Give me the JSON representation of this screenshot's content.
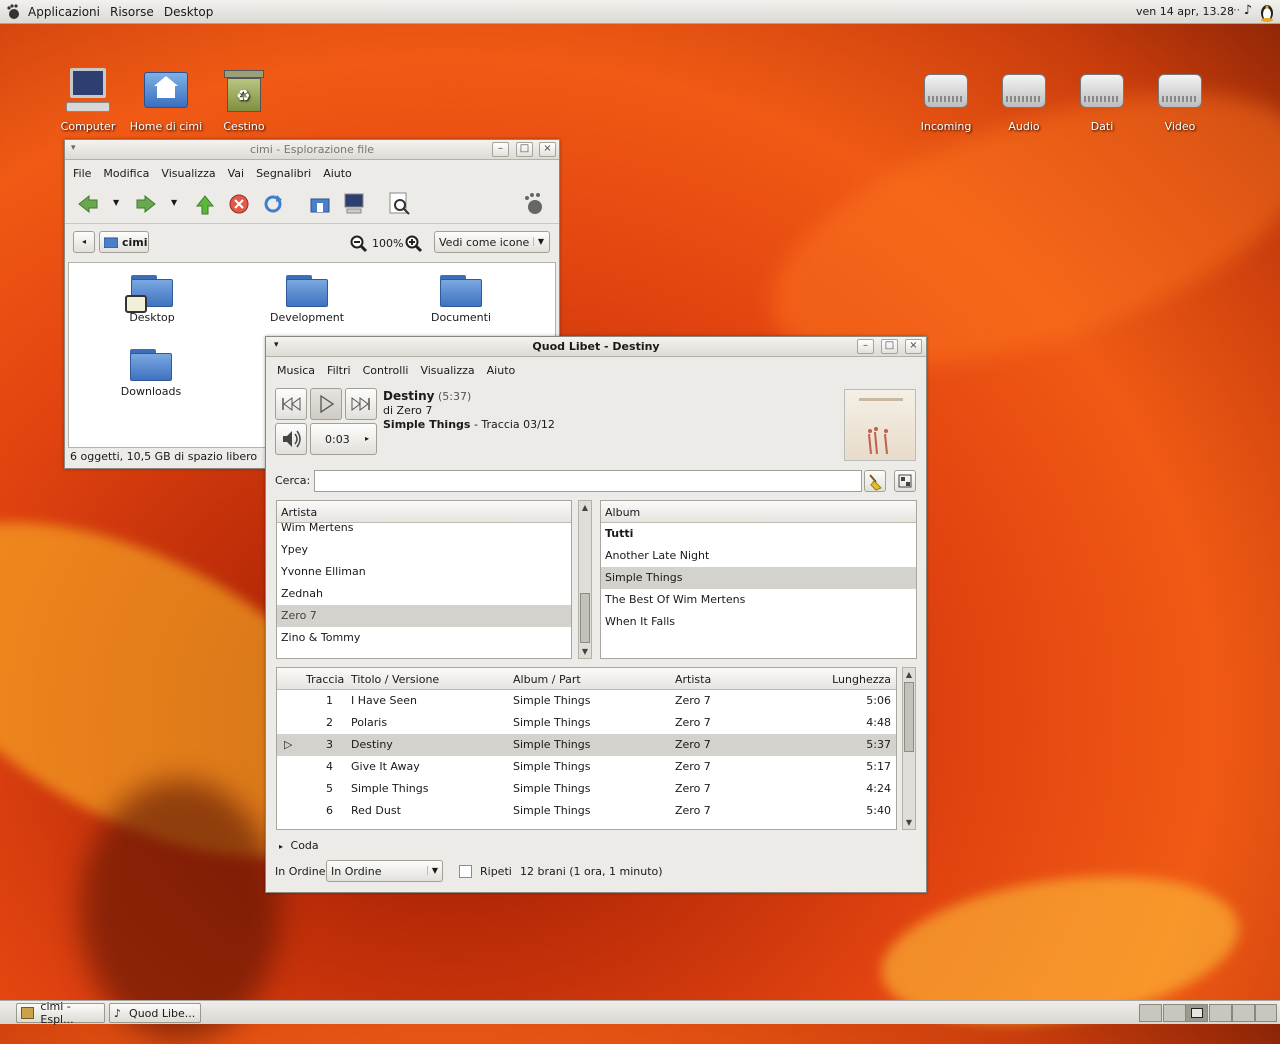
{
  "top_panel": {
    "menus": [
      "Applicazioni",
      "Risorse",
      "Desktop"
    ],
    "clock": "ven 14 apr, 13.28"
  },
  "desktop_icons": {
    "left": [
      "Computer",
      "Home di cimi",
      "Cestino"
    ],
    "right": [
      "Incoming",
      "Audio",
      "Dati",
      "Video"
    ]
  },
  "file_manager": {
    "title": "cimi - Esplorazione file",
    "menu": [
      "File",
      "Modifica",
      "Visualizza",
      "Vai",
      "Segnalibri",
      "Aiuto"
    ],
    "location": "cimi",
    "zoom": "100%",
    "view_mode": "Vedi come icone",
    "folders": [
      "Desktop",
      "Development",
      "Documenti",
      "Downloads"
    ],
    "status": "6 oggetti, 10,5 GB di spazio libero"
  },
  "quodlibet": {
    "title": "Quod Libet - Destiny",
    "menu": [
      "Musica",
      "Filtri",
      "Controlli",
      "Visualizza",
      "Aiuto"
    ],
    "now_playing": {
      "song": "Destiny",
      "length": "(5:37)",
      "artist": "di Zero 7",
      "album": "Simple Things",
      "track_info": " - Traccia 03/12",
      "position": "0:03"
    },
    "search_label": "Cerca:",
    "search_value": "",
    "artist_header": "Artista",
    "artists": [
      "Wim Mertens",
      "Ypey",
      "Yvonne Elliman",
      "Zednah",
      "Zero 7",
      "Zino & Tommy"
    ],
    "selected_artist_index": 4,
    "album_header": "Album",
    "albums": [
      "Tutti",
      "Another Late Night",
      "Simple Things",
      "The Best Of Wim Mertens",
      "When It Falls"
    ],
    "selected_album_index": 2,
    "song_columns": [
      "Traccia",
      "Titolo / Versione",
      "Album / Part",
      "Artista",
      "Lunghezza"
    ],
    "songs": [
      {
        "track": "1",
        "title": "I Have Seen",
        "album": "Simple Things",
        "artist": "Zero 7",
        "length": "5:06"
      },
      {
        "track": "2",
        "title": "Polaris",
        "album": "Simple Things",
        "artist": "Zero 7",
        "length": "4:48"
      },
      {
        "track": "3",
        "title": "Destiny",
        "album": "Simple Things",
        "artist": "Zero 7",
        "length": "5:37"
      },
      {
        "track": "4",
        "title": "Give It Away",
        "album": "Simple Things",
        "artist": "Zero 7",
        "length": "5:17"
      },
      {
        "track": "5",
        "title": "Simple Things",
        "album": "Simple Things",
        "artist": "Zero 7",
        "length": "4:24"
      },
      {
        "track": "6",
        "title": "Red Dust",
        "album": "Simple Things",
        "artist": "Zero 7",
        "length": "5:40"
      }
    ],
    "playing_index": 2,
    "queue_label": "Coda",
    "order_label": "In Ordine",
    "order_value": "In Ordine",
    "repeat_label": "Ripeti",
    "summary": "12 brani (1 ora, 1 minuto)"
  },
  "taskbar": {
    "tasks": [
      "cimi - Espl...",
      "Quod Libe..."
    ]
  },
  "colors": {
    "selection": "#d4d2cd",
    "window_bg": "#edebe7",
    "folder_blue": "#3f72c0"
  }
}
